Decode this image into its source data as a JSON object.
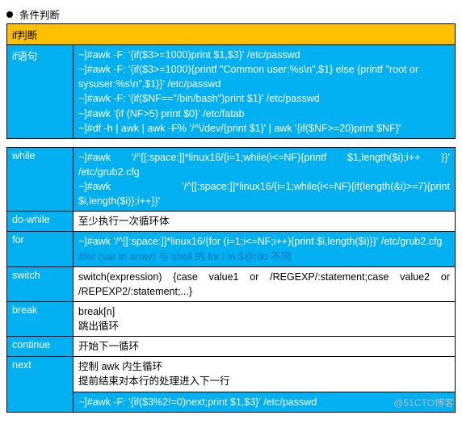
{
  "heading": "条件判断",
  "t1": {
    "header": "if判断",
    "row1_label": "if语句",
    "row1_lines": [
      "~]#awk -F: '{if($3>=1000)print $1,$3}' /etc/passwd",
      "~]#awk -F: '{if($3>=1000){printf \"Common user:%s\\n\",$1} else {printf \"root or sysuser:%s\\n\",$1}}' /etc/passwd",
      "~]#awk -F: '{if($NF==\"/bin/bash\")print $1}' /etc/passwd",
      "~]#awk '{if (NF>5) print $0}' /etc/fatab",
      "~]#df -h | awk | awk -F% '/^\\/dev/{print $1}' | awk '{if($NF>=20)print $NF}'"
    ]
  },
  "t2": {
    "rows": [
      {
        "label": "while",
        "label_cls": "cell-blue",
        "body_cls": "cell-blue",
        "lines": [
          "~]#awk '/^[[:space:]]*linux16/{i=1;while(i<=NF){printf  $1,length($i);i++ }}' /etc/grub2.cfg",
          "~]#awk  '/^[[:space:]]*linux16/{i=1;while(i<=NF){if(length(&i)>=7){print $i,length($i)};i++}}'"
        ]
      },
      {
        "label": "do-while",
        "label_cls": "cell-blue",
        "body_cls": "cell-white",
        "lines": [
          "至少执行一次循环体"
        ]
      },
      {
        "label": "for",
        "label_cls": "cell-blue",
        "body_cls": "cell-blue",
        "lines": [
          "~]#awk  '/^[[:space:]]*linux16/{for  (i=1;i<=NF;i++){print  $i,length($i)}}' /etc/grub2.cfg"
        ],
        "note": "#for (var in array)                与 shell 的 for i in $@;do 不同"
      },
      {
        "label": "switch",
        "label_cls": "cell-blue",
        "body_cls": "cell-white",
        "lines": [
          "switch(expression)  {case  value1  or  /REGEXP/:statement;case  value2  or /REPEXP2/:statement;...}"
        ]
      },
      {
        "label": "break",
        "label_cls": "cell-blue",
        "body_cls": "cell-white",
        "lines": [
          "break[n]",
          "跳出循环"
        ]
      },
      {
        "label": "continue",
        "label_cls": "cell-blue",
        "body_cls": "cell-white",
        "lines": [
          "开始下一循环"
        ]
      },
      {
        "label": "next",
        "label_cls": "cell-blue",
        "body_cls": "cell-white",
        "lines": [
          "控制 awk 内生循环",
          "提前结束对本行的处理进入下一行"
        ],
        "sub_blue": "~]#awk -F: '{if($3%2!=0)next;print $1,$3}' /etc/passwd"
      }
    ]
  },
  "watermark": "@51CTO博客"
}
